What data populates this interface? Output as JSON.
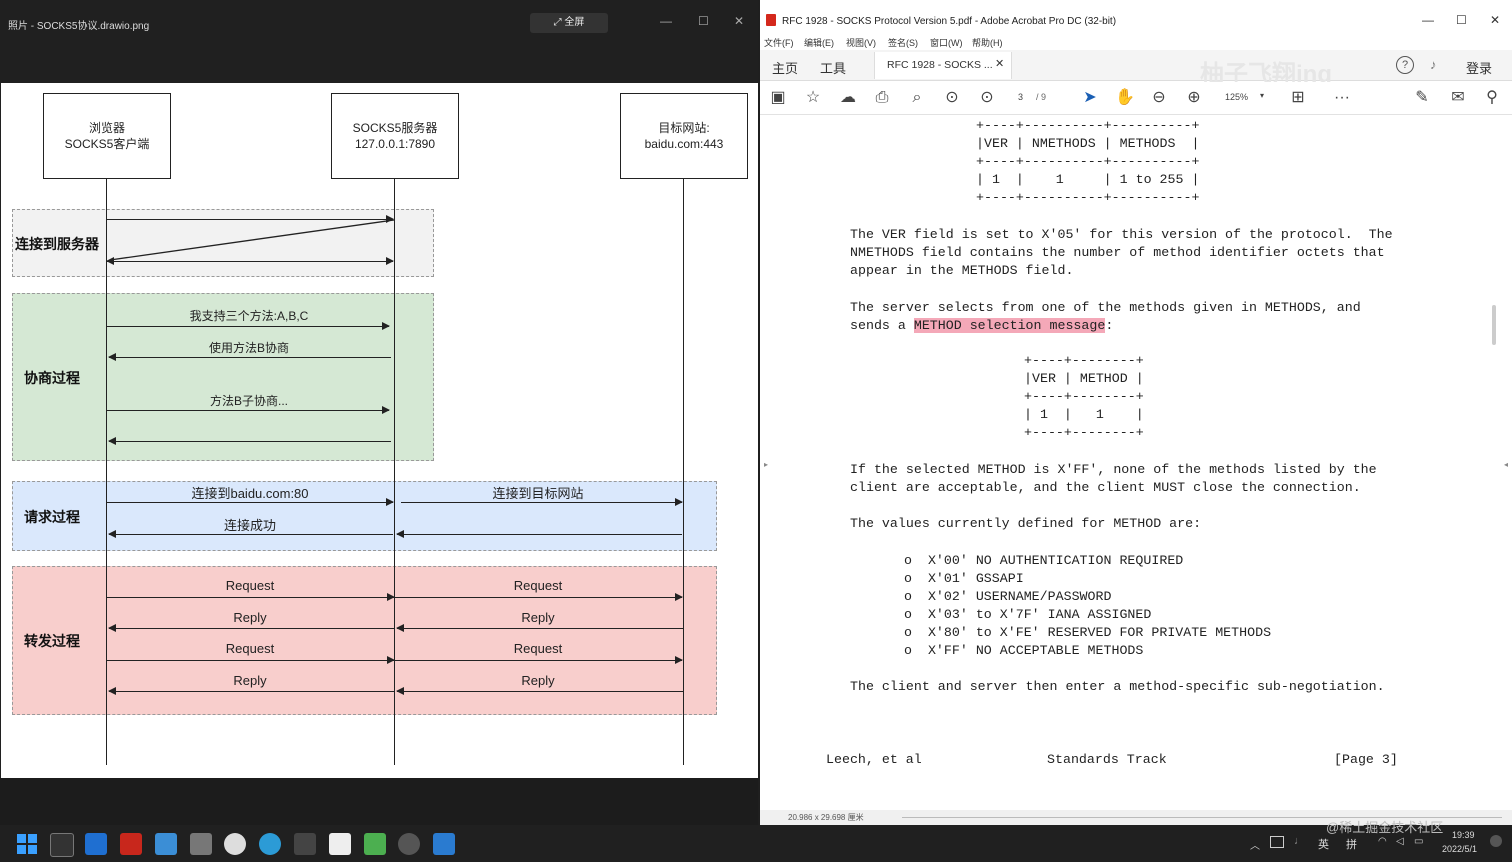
{
  "viewer": {
    "title": "照片 - SOCKS5协议.drawio.png",
    "fullscreen_label": "⤢ 全屏",
    "controls": [
      "—",
      "☐",
      "✕"
    ]
  },
  "diagram": {
    "participants": [
      {
        "line1": "浏览器",
        "line2": "SOCKS5客户端"
      },
      {
        "line1": "SOCKS5服务器",
        "line2": "127.0.0.1:7890"
      },
      {
        "line1": "目标网站:",
        "line2": "baidu.com:443"
      }
    ],
    "regions": [
      {
        "label": "连接到服务器",
        "color": "#f2f2f2"
      },
      {
        "label": "协商过程",
        "color": "#d5e8d4"
      },
      {
        "label": "请求过程",
        "color": "#dae8fc"
      },
      {
        "label": "转发过程",
        "color": "#f8cecc"
      }
    ],
    "messages": {
      "m1": "我支持三个方法:A,B,C",
      "m2": "使用方法B协商",
      "m3": "方法B子协商...",
      "m4": "连接到baidu.com:80",
      "m5": "连接到目标网站",
      "m6": "连接成功",
      "request": "Request",
      "reply": "Reply"
    }
  },
  "acrobat": {
    "title": "RFC 1928 - SOCKS Protocol Version 5.pdf - Adobe Acrobat Pro DC (32-bit)",
    "menu": [
      "文件(F)",
      "编辑(E)",
      "视图(V)",
      "签名(S)",
      "窗口(W)",
      "帮助(H)"
    ],
    "tabs": {
      "home": "主页",
      "tools": "工具",
      "doc": "RFC 1928 - SOCKS ...",
      "signin": "登录"
    },
    "watermark": "柚子飞翔ing",
    "page_current": "3",
    "page_total": "/ 9",
    "zoom": "125%",
    "status": "20.986 x 29.698 厘米",
    "doc_lines": {
      "t1": "+----+----------+----------+",
      "t2": "|VER | NMETHODS | METHODS  |",
      "t3": "+----+----------+----------+",
      "t4": "| 1  |    1     | 1 to 255 |",
      "t5": "+----+----------+----------+",
      "p1a": "The VER field is set to X'05' for this version of the protocol.  The",
      "p1b": "NMETHODS field contains the number of method identifier octets that",
      "p1c": "appear in the METHODS field.",
      "p2a": "The server selects from one of the methods given in METHODS, and",
      "p2b_pre": "sends a ",
      "p2b_hl": "METHOD selection message",
      "p2b_post": ":",
      "s1": "+----+--------+",
      "s2": "|VER | METHOD |",
      "s3": "+----+--------+",
      "s4": "| 1  |   1    |",
      "s5": "+----+--------+",
      "p3a": "If the selected METHOD is X'FF', none of the methods listed by the",
      "p3b": "client are acceptable, and the client MUST close the connection.",
      "p4": "The values currently defined for METHOD are:",
      "li1": "o  X'00' NO AUTHENTICATION REQUIRED",
      "li2": "o  X'01' GSSAPI",
      "li3": "o  X'02' USERNAME/PASSWORD",
      "li4": "o  X'03' to X'7F' IANA ASSIGNED",
      "li5": "o  X'80' to X'FE' RESERVED FOR PRIVATE METHODS",
      "li6": "o  X'FF' NO ACCEPTABLE METHODS",
      "p5": "The client and server then enter a method-specific sub-negotiation.",
      "footer_left": "Leech, et al",
      "footer_mid": "Standards Track",
      "footer_right": "[Page 3]"
    }
  },
  "taskbar": {
    "ime1": "英",
    "ime2": "拼",
    "time": "19:39",
    "date": "2022/5/1",
    "site_watermark": "@稀土掘金技术社区"
  }
}
